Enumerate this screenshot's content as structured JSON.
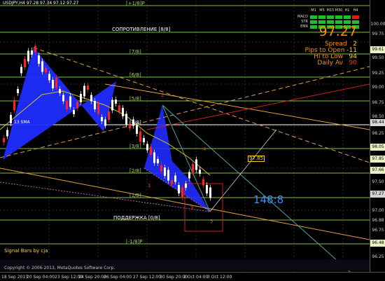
{
  "symbol_info": "USDJPY,H4  97.28 97.34 97.12 97.27",
  "murray": {
    "top_plus1": "[+1/8]P",
    "resistance": "СОПРОТИВЛЕНИЕ [8/8]",
    "l7": "[7/8]",
    "l6": "[6/8]",
    "l5": "[5/8]",
    "l4": "[4/8]",
    "l3": "[3/8]",
    "l2": "[2/8]",
    "l1": "[1/8]",
    "support": "ПОДДЕРЖКА [0/8]",
    "minus1": "[-1/8]P"
  },
  "ma_label": "13 SMA",
  "signal_label": "Signal Bars by cja",
  "copyright": "Copyright © 2006-2013, MetaQuotes Software Corp.",
  "price_label": "97.85",
  "pattern_ratio": "148:8",
  "wave_points": [
    "1",
    "2",
    "3",
    "4",
    "5"
  ],
  "indicator_panel": {
    "timeframes": [
      "M1",
      "M5",
      "M15",
      "M30",
      "H1",
      "H4"
    ],
    "rows": [
      "MACD",
      "STR",
      "EMA"
    ],
    "states": [
      [
        "green",
        "green",
        "green",
        "green",
        "green",
        "red"
      ],
      [
        "green",
        "green",
        "green",
        "green",
        "green",
        "green"
      ],
      [
        "green",
        "green",
        "green",
        "green",
        "green",
        "green"
      ]
    ]
  },
  "info_panel": {
    "price": "97.27",
    "spread_label": "Spread",
    "spread_value": "2",
    "pips_label": "Pips to Open",
    "pips_value": "-11",
    "hilo_label": "Hi to Low",
    "hilo_value": "94",
    "daily_label": "Daily Av",
    "daily_value": "90"
  },
  "price_axis": [
    {
      "label": "100.00",
      "style": "plain"
    },
    {
      "label": "99.75",
      "style": "plain"
    },
    {
      "label": "99.61",
      "style": "lvl"
    },
    {
      "label": "99.50",
      "style": "plain"
    },
    {
      "label": "99.25",
      "style": "plain"
    },
    {
      "label": "99.00",
      "style": "plain"
    },
    {
      "label": "98.75",
      "style": "plain"
    },
    {
      "label": "98.50",
      "style": "plain"
    },
    {
      "label": "98.44",
      "style": "mark"
    },
    {
      "label": "98.25",
      "style": "plain"
    },
    {
      "label": "98.05",
      "style": "lvl"
    },
    {
      "label": "97.85",
      "style": "lvl"
    },
    {
      "label": "97.66",
      "style": "lvl"
    },
    {
      "label": "97.50",
      "style": "plain"
    },
    {
      "label": "97.27",
      "style": "bid"
    },
    {
      "label": "97.00",
      "style": "plain"
    },
    {
      "label": "96.88",
      "style": "plain"
    },
    {
      "label": "96.75",
      "style": "plain"
    },
    {
      "label": "96.48",
      "style": "lvl"
    },
    {
      "label": "96.25",
      "style": "plain"
    }
  ],
  "time_axis": [
    "18 Sep 2013",
    "20 Sep 04:00",
    "23 Sep 12:00",
    "24 Sep 20:00",
    "26 Sep 04:00",
    "27 Sep 12:00",
    "30 Sep 20:00",
    "2 Oct 04:00",
    "3 Oct 12:00"
  ],
  "colors": {
    "background": "#000000",
    "bull_candle": "#ffffff",
    "bear_candle": "#ff2020",
    "harmonic_fill": "#1f2cff",
    "murray_lines": "#7fbf3a",
    "trend_orange": "#e0a040",
    "info_price": "#ff8c00",
    "pattern_ratio": "#3a8cff"
  }
}
